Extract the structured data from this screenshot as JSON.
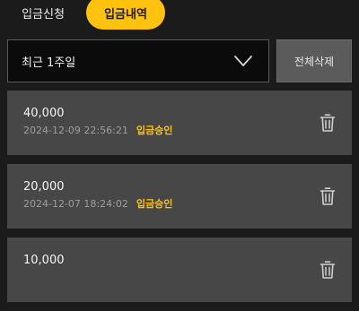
{
  "tabs": {
    "apply_label": "입금신청",
    "history_label": "입금내역"
  },
  "filter": {
    "period_value": "최근 1주일",
    "delete_all_label": "전체삭제"
  },
  "history": [
    {
      "amount": "40,000",
      "datetime": "2024-12-09 22:56:21",
      "status": "입금승인"
    },
    {
      "amount": "20,000",
      "datetime": "2024-12-07 18:24:02",
      "status": "입금승인"
    },
    {
      "amount": "10,000",
      "datetime": "",
      "status": ""
    }
  ],
  "icons": {
    "dropdown": "chevron-down-icon",
    "delete": "trash-icon"
  },
  "colors": {
    "accent": "#ffc20e",
    "background": "#1b1b1b",
    "card": "#474747"
  }
}
